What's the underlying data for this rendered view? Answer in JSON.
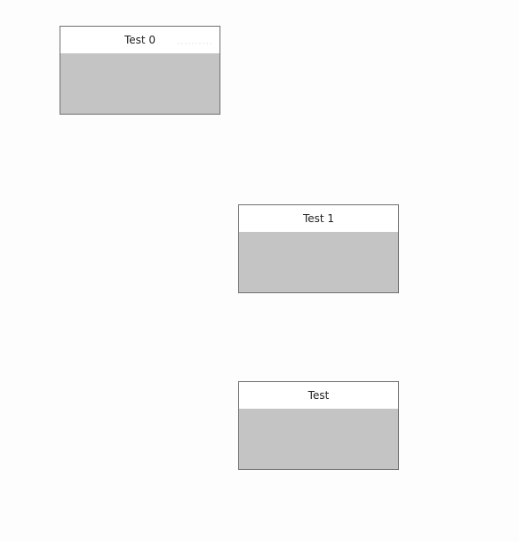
{
  "cards": [
    {
      "title": "Test 0"
    },
    {
      "title": "Test 1"
    },
    {
      "title": "Test"
    }
  ]
}
